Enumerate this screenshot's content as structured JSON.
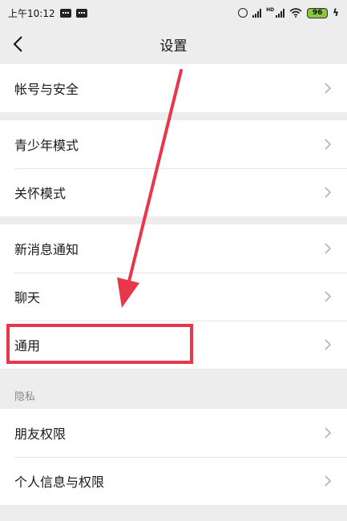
{
  "status_bar": {
    "time": "上午10:12",
    "signal_badge": "HD",
    "battery": "96"
  },
  "nav": {
    "title": "设置"
  },
  "groups": [
    {
      "items": [
        {
          "label": "帐号与安全"
        }
      ]
    },
    {
      "items": [
        {
          "label": "青少年模式"
        },
        {
          "label": "关怀模式"
        }
      ]
    },
    {
      "items": [
        {
          "label": "新消息通知"
        },
        {
          "label": "聊天"
        },
        {
          "label": "通用"
        }
      ]
    }
  ],
  "privacy": {
    "section_label": "隐私",
    "items": [
      {
        "label": "朋友权限"
      },
      {
        "label": "个人信息与权限"
      }
    ]
  },
  "colors": {
    "background": "#ededed",
    "row_bg": "#ffffff",
    "annotation_red": "#e8374a",
    "battery_green": "#8cc63f"
  }
}
